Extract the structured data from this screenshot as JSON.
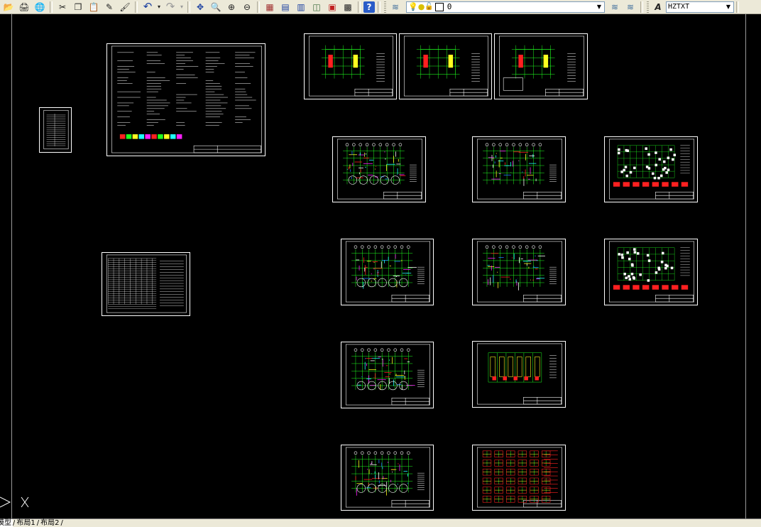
{
  "app": {
    "accent": "#ece9d8"
  },
  "toolbar": {
    "buttons": [
      {
        "name": "open-icon",
        "glyph": "📂"
      },
      {
        "name": "publish-icon",
        "glyph": "🖨"
      },
      {
        "name": "globe-icon",
        "glyph": "🌐"
      },
      {
        "name": "cut-icon",
        "glyph": "✂"
      },
      {
        "name": "copy-icon",
        "glyph": "❐"
      },
      {
        "name": "paste-icon",
        "glyph": "📋"
      },
      {
        "name": "match-properties-icon",
        "glyph": "✎"
      },
      {
        "name": "brush-icon",
        "glyph": "🖌"
      },
      {
        "name": "undo-icon",
        "glyph": "↶"
      },
      {
        "name": "redo-icon",
        "glyph": "↷"
      },
      {
        "name": "pan-icon",
        "glyph": "✥"
      },
      {
        "name": "zoom-realtime-icon",
        "glyph": "🔍"
      },
      {
        "name": "zoom-window-icon",
        "glyph": "⊕"
      },
      {
        "name": "zoom-previous-icon",
        "glyph": "⊖"
      },
      {
        "name": "properties-icon",
        "glyph": "▦"
      },
      {
        "name": "design-center-icon",
        "glyph": "▤"
      },
      {
        "name": "tool-palettes-icon",
        "glyph": "▥"
      },
      {
        "name": "sheet-set-icon",
        "glyph": "◫"
      },
      {
        "name": "markup-icon",
        "glyph": "▣"
      },
      {
        "name": "calculator-icon",
        "glyph": "▩"
      },
      {
        "name": "help-icon",
        "glyph": "?"
      }
    ],
    "layer_state": {
      "value": "0"
    },
    "text_style": {
      "value": "HZTXT"
    }
  },
  "tabs": [
    {
      "label": "模型",
      "active": true
    },
    {
      "label": "布局1",
      "active": false
    },
    {
      "label": "布局2",
      "active": false
    }
  ]
}
